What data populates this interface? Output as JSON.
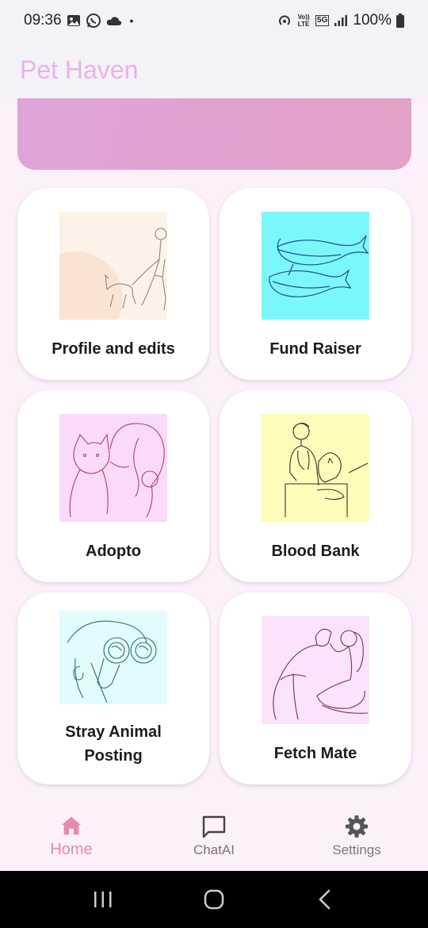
{
  "status_bar": {
    "time": "09:36",
    "battery": "100%",
    "dot": "•",
    "network_tag": "5G",
    "volte_tag": "Vo)) LTE"
  },
  "app": {
    "title": "Pet Haven"
  },
  "colors": {
    "title": "#e9b1ee",
    "banner_start": "#dfa3d8",
    "banner_end": "#e3a2c7",
    "active_nav": "#e889ab",
    "background": "#fcf1fb"
  },
  "cards": [
    {
      "label": "Profile and edits",
      "icon": "woman-walking-dog-illustration",
      "bg": "#fdf2e7"
    },
    {
      "label": "Fund Raiser",
      "icon": "whales-illustration",
      "bg": "#79f7fa"
    },
    {
      "label": "Adopto",
      "icon": "woman-with-cat-illustration",
      "bg": "#fbd9f9"
    },
    {
      "label": "Blood Bank",
      "icon": "vet-with-dog-illustration",
      "bg": "#fdfdb9"
    },
    {
      "label": "Stray Animal Posting",
      "icon": "binoculars-illustration",
      "bg": "#e2fcfb"
    },
    {
      "label": "Fetch Mate",
      "icon": "woman-and-dog-illustration",
      "bg": "#fbe3fb"
    }
  ],
  "bottom_nav": {
    "items": [
      {
        "label": "Home",
        "icon": "home-icon",
        "active": true
      },
      {
        "label": "ChatAI",
        "icon": "chat-icon",
        "active": false
      },
      {
        "label": "Settings",
        "icon": "gear-icon",
        "active": false
      }
    ]
  },
  "system_nav": {
    "recents": "recents-icon",
    "home": "home-circle-icon",
    "back": "back-icon"
  }
}
